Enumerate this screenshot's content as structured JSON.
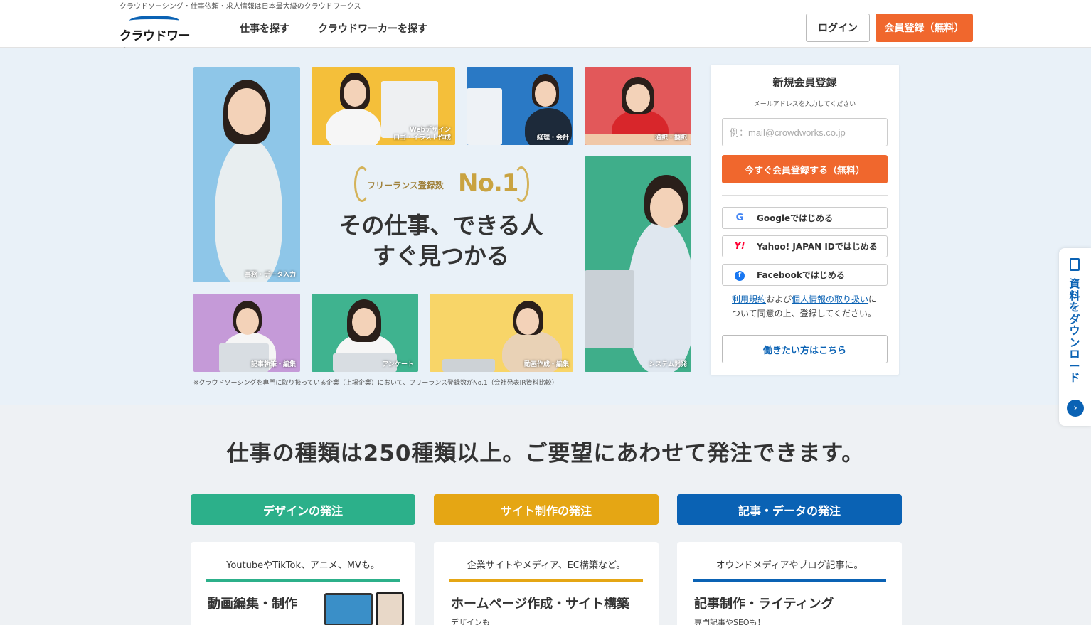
{
  "header": {
    "tagline": "クラウドソーシング・仕事依頼・求人情報は日本最大級のクラウドワークス",
    "logo_text": "クラウドワークス",
    "nav": [
      "仕事を探す",
      "クラウドワーカーを探す"
    ],
    "login_label": "ログイン",
    "register_label": "会員登録（無料）"
  },
  "hero": {
    "award_text": "フリーランス登録数",
    "award_no1": "No.1",
    "title_line1": "その仕事、できる人",
    "title_line2": "すぐ見つかる",
    "note": "※クラウドソーシングを専門に取り扱っている企業（上場企業）において、フリーランス登録数がNo.1（会社発表IR資料比較）",
    "tiles": [
      {
        "label": "事務・データ入力",
        "color": "#8ec6e8"
      },
      {
        "label_l1": "Webデザイン",
        "label_l2": "ロゴ・イラスト作成",
        "color": "#f4bf3a"
      },
      {
        "label": "経理・会計",
        "color": "#2a79c5"
      },
      {
        "label": "通訳・翻訳",
        "color": "#e2585a"
      },
      {
        "label": "システム開発",
        "color": "#3fae8a"
      },
      {
        "label": "記事執筆・編集",
        "color": "#c59ad8"
      },
      {
        "label": "アンケート",
        "color": "#3fb38f"
      },
      {
        "label": "動画作成・編集",
        "color": "#f8d568"
      }
    ]
  },
  "signup": {
    "title": "新規会員登録",
    "subtitle": "メールアドレスを入力してください",
    "email_placeholder": "例：mail@crowdworks.co.jp",
    "submit_label": "今すぐ会員登録する（無料）",
    "google_label": "Googleではじめる",
    "yahoo_label": "Yahoo! JAPAN IDではじめる",
    "facebook_label": "Facebookではじめる",
    "terms_link1": "利用規約",
    "terms_mid": "および",
    "terms_link2": "個人情報の取り扱い",
    "terms_tail": "について同意の上、登録してください。",
    "work_label": "働きたい方はこちら"
  },
  "side_tab": {
    "label": "資料をダウンロード"
  },
  "section": {
    "title": "仕事の種類は250種類以上。ご要望にあわせて発注できます。",
    "categories": [
      {
        "button": "デザインの発注",
        "color": "#2cb08a",
        "sub": "YoutubeやTikTok、アニメ、MVも。",
        "heading": "動画編集・制作",
        "small": ""
      },
      {
        "button": "サイト制作の発注",
        "color": "#e5a614",
        "sub": "企業サイトやメディア、EC構築など。",
        "heading": "ホームページ作成・サイト構築",
        "small": "デザインも"
      },
      {
        "button": "記事・データの発注",
        "color": "#0a62b4",
        "sub": "オウンドメディアやブログ記事に。",
        "heading": "記事制作・ライティング",
        "small": "専門記事やSEOも！"
      }
    ]
  }
}
